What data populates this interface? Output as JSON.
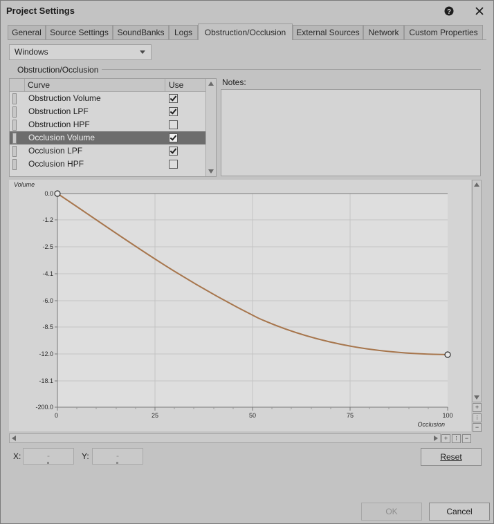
{
  "window": {
    "title": "Project Settings",
    "help_icon": "help-icon",
    "close_icon": "close-icon"
  },
  "tabs": [
    {
      "label": "General"
    },
    {
      "label": "Source Settings"
    },
    {
      "label": "SoundBanks"
    },
    {
      "label": "Logs"
    },
    {
      "label": "Obstruction/Occlusion",
      "active": true
    },
    {
      "label": "External Sources"
    },
    {
      "label": "Network"
    },
    {
      "label": "Custom Properties"
    }
  ],
  "platform": {
    "selected": "Windows"
  },
  "group": {
    "label": "Obstruction/Occlusion"
  },
  "curve_list": {
    "col_curve": "Curve",
    "col_use": "Use",
    "rows": [
      {
        "label": "Obstruction Volume",
        "use": true
      },
      {
        "label": "Obstruction LPF",
        "use": true
      },
      {
        "label": "Obstruction HPF",
        "use": false
      },
      {
        "label": "Occlusion Volume",
        "use": true,
        "selected": true
      },
      {
        "label": "Occlusion LPF",
        "use": true
      },
      {
        "label": "Occlusion HPF",
        "use": false
      }
    ]
  },
  "notes": {
    "label": "Notes:",
    "value": ""
  },
  "graph": {
    "y_axis_label": "Volume",
    "x_axis_label": "Occlusion",
    "y_ticks": [
      "0.0",
      "-1.2",
      "-2.5",
      "-4.1",
      "-6.0",
      "-8.5",
      "-12.0",
      "-18.1",
      "-200.0"
    ],
    "x_ticks": [
      "0",
      "25",
      "50",
      "75",
      "100"
    ],
    "curve_color": "#a7764d",
    "points": [
      {
        "x": 0,
        "y": "0.0"
      },
      {
        "x": 100,
        "y": "-12.0"
      }
    ]
  },
  "coords": {
    "x_label": "X:",
    "x_value": "-",
    "y_label": "Y:",
    "y_value": "-"
  },
  "buttons": {
    "reset": "Reset",
    "ok": "OK",
    "cancel": "Cancel"
  }
}
